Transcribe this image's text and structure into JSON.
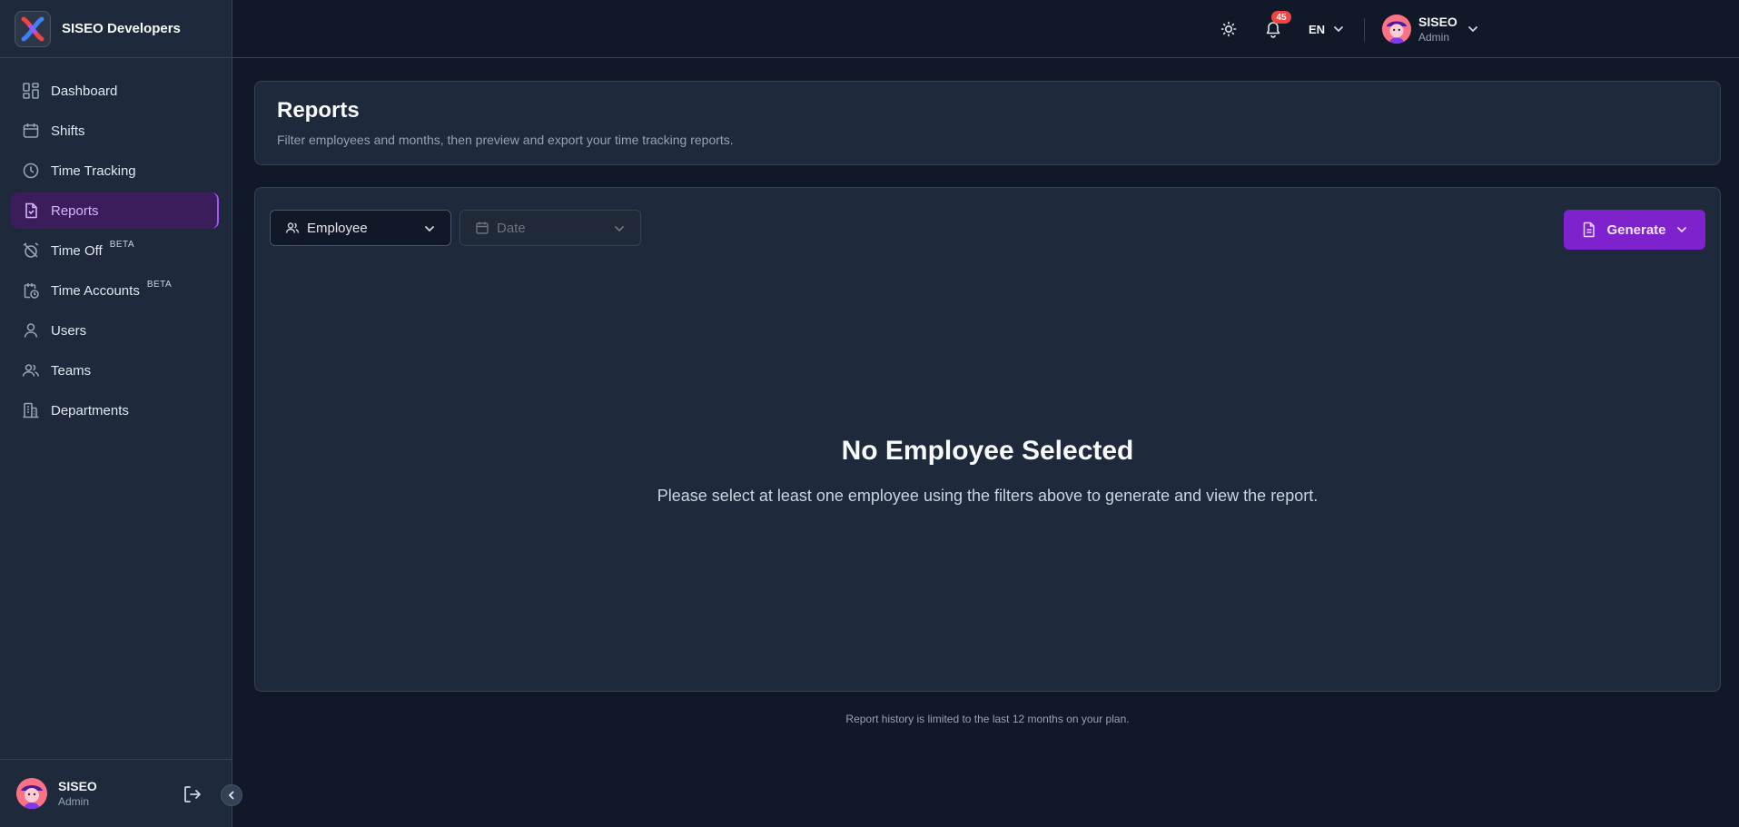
{
  "brand": {
    "name": "SISEO Developers"
  },
  "sidebar": {
    "items": [
      {
        "label": "Dashboard",
        "icon": "dashboard-icon"
      },
      {
        "label": "Shifts",
        "icon": "calendar-icon"
      },
      {
        "label": "Time Tracking",
        "icon": "clock-icon"
      },
      {
        "label": "Reports",
        "icon": "report-icon",
        "active": true
      },
      {
        "label": "Time Off",
        "icon": "alarm-off-icon",
        "badge": "BETA"
      },
      {
        "label": "Time Accounts",
        "icon": "time-account-icon",
        "badge": "BETA"
      },
      {
        "label": "Users",
        "icon": "user-icon"
      },
      {
        "label": "Teams",
        "icon": "team-icon"
      },
      {
        "label": "Departments",
        "icon": "building-icon"
      }
    ],
    "footer": {
      "name": "SISEO",
      "role": "Admin"
    }
  },
  "topbar": {
    "notifications_count": "45",
    "language": "EN",
    "user": {
      "name": "SISEO",
      "role": "Admin"
    }
  },
  "header": {
    "title": "Reports",
    "subtitle": "Filter employees and months, then preview and export your time tracking reports."
  },
  "filters": {
    "employee_label": "Employee",
    "date_label": "Date"
  },
  "actions": {
    "generate_label": "Generate"
  },
  "empty_state": {
    "title": "No Employee Selected",
    "text": "Please select at least one employee using the filters above to generate and view the report."
  },
  "footnote": "Report history is limited to the last 12 months on your plan.",
  "colors": {
    "accent": "#7e22ce",
    "active_nav_bg": "#3b1d5c",
    "badge": "#ef4444",
    "background": "#111827",
    "card": "#1e293b"
  }
}
